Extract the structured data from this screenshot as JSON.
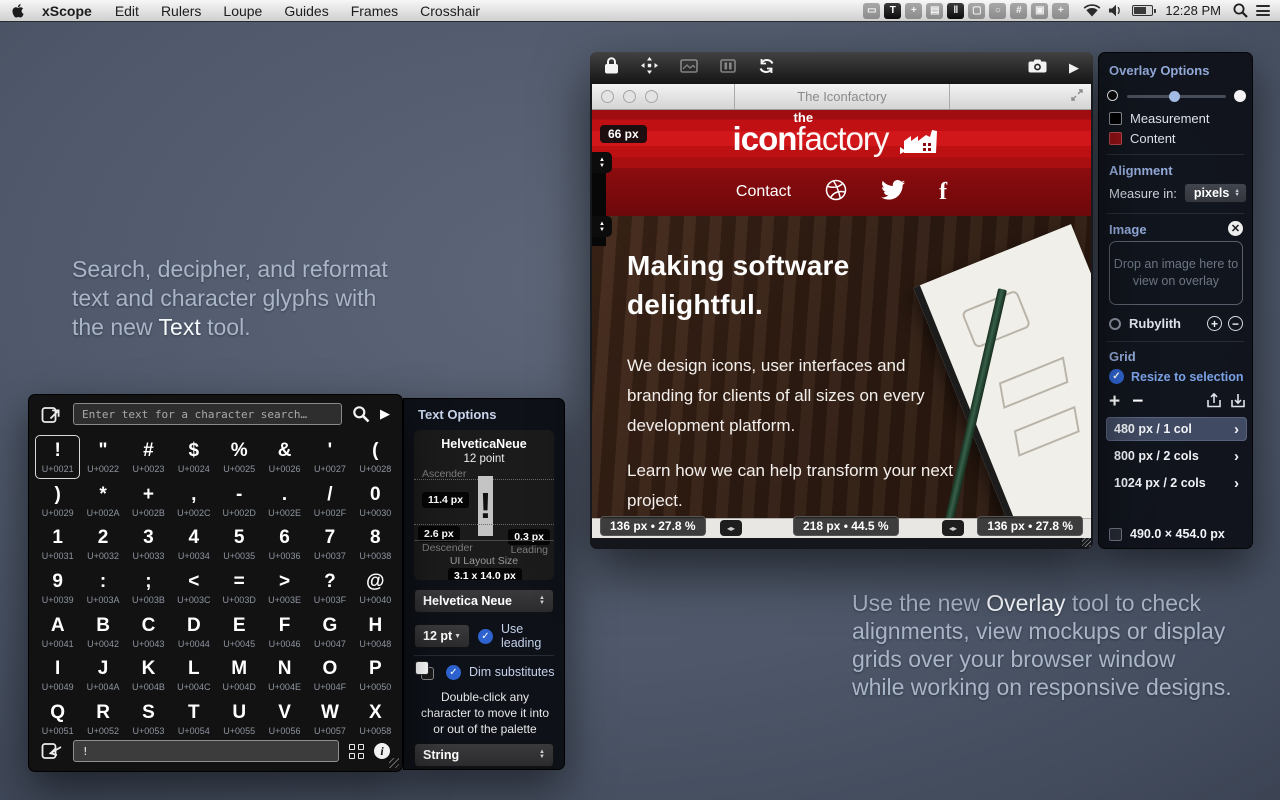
{
  "menu_bar": {
    "items": [
      "xScope",
      "Edit",
      "Rulers",
      "Loupe",
      "Guides",
      "Frames",
      "Crosshair"
    ],
    "clock": "12:28 PM",
    "tool_icons": [
      {
        "name": "dimensions-tool",
        "glyph": "▭",
        "active": false
      },
      {
        "name": "text-tool",
        "glyph": "T",
        "active": true
      },
      {
        "name": "crosshair-tool",
        "glyph": "+",
        "active": false
      },
      {
        "name": "ruler-tool",
        "glyph": "▤",
        "active": false
      },
      {
        "name": "columns-tool",
        "glyph": "‖",
        "active": true
      },
      {
        "name": "frames-tool",
        "glyph": "▢",
        "active": false
      },
      {
        "name": "loupe-tool",
        "glyph": "○",
        "active": false
      },
      {
        "name": "grid-tool",
        "glyph": "#",
        "active": false
      },
      {
        "name": "overlay-tool",
        "glyph": "▣",
        "active": false
      },
      {
        "name": "guides-tool",
        "glyph": "+",
        "active": false
      }
    ]
  },
  "captions": {
    "left_pre": "Search, decipher, and reformat\ntext and character glyphs with\nthe new ",
    "left_hl": "Text",
    "left_post": " tool.",
    "right_pre": "Use the new ",
    "right_hl": "Overlay",
    "right_post": " tool to check\nalignments, view mockups or display\ngrids over your browser window\nwhile working on responsive designs."
  },
  "palette": {
    "search_placeholder": "Enter text for a character search…",
    "input_value": "!",
    "cells": [
      {
        "c": "!",
        "u": "U+0021",
        "selected": true
      },
      {
        "c": "\"",
        "u": "U+0022"
      },
      {
        "c": "#",
        "u": "U+0023"
      },
      {
        "c": "$",
        "u": "U+0024"
      },
      {
        "c": "%",
        "u": "U+0025"
      },
      {
        "c": "&",
        "u": "U+0026"
      },
      {
        "c": "'",
        "u": "U+0027"
      },
      {
        "c": "(",
        "u": "U+0028"
      },
      {
        "c": ")",
        "u": "U+0029"
      },
      {
        "c": "*",
        "u": "U+002A"
      },
      {
        "c": "+",
        "u": "U+002B"
      },
      {
        "c": ",",
        "u": "U+002C"
      },
      {
        "c": "-",
        "u": "U+002D"
      },
      {
        "c": ".",
        "u": "U+002E"
      },
      {
        "c": "/",
        "u": "U+002F"
      },
      {
        "c": "0",
        "u": "U+0030"
      },
      {
        "c": "1",
        "u": "U+0031"
      },
      {
        "c": "2",
        "u": "U+0032"
      },
      {
        "c": "3",
        "u": "U+0033"
      },
      {
        "c": "4",
        "u": "U+0034"
      },
      {
        "c": "5",
        "u": "U+0035"
      },
      {
        "c": "6",
        "u": "U+0036"
      },
      {
        "c": "7",
        "u": "U+0037"
      },
      {
        "c": "8",
        "u": "U+0038"
      },
      {
        "c": "9",
        "u": "U+0039"
      },
      {
        "c": ":",
        "u": "U+003A"
      },
      {
        "c": ";",
        "u": "U+003B"
      },
      {
        "c": "<",
        "u": "U+003C"
      },
      {
        "c": "=",
        "u": "U+003D"
      },
      {
        "c": ">",
        "u": "U+003E"
      },
      {
        "c": "?",
        "u": "U+003F"
      },
      {
        "c": "@",
        "u": "U+0040"
      },
      {
        "c": "A",
        "u": "U+0041"
      },
      {
        "c": "B",
        "u": "U+0042"
      },
      {
        "c": "C",
        "u": "U+0043"
      },
      {
        "c": "D",
        "u": "U+0044"
      },
      {
        "c": "E",
        "u": "U+0045"
      },
      {
        "c": "F",
        "u": "U+0046"
      },
      {
        "c": "G",
        "u": "U+0047"
      },
      {
        "c": "H",
        "u": "U+0048"
      },
      {
        "c": "I",
        "u": "U+0049"
      },
      {
        "c": "J",
        "u": "U+004A"
      },
      {
        "c": "K",
        "u": "U+004B"
      },
      {
        "c": "L",
        "u": "U+004C"
      },
      {
        "c": "M",
        "u": "U+004D"
      },
      {
        "c": "N",
        "u": "U+004E"
      },
      {
        "c": "O",
        "u": "U+004F"
      },
      {
        "c": "P",
        "u": "U+0050"
      },
      {
        "c": "Q",
        "u": "U+0051"
      },
      {
        "c": "R",
        "u": "U+0052"
      },
      {
        "c": "S",
        "u": "U+0053"
      },
      {
        "c": "T",
        "u": "U+0054"
      },
      {
        "c": "U",
        "u": "U+0055"
      },
      {
        "c": "V",
        "u": "U+0056"
      },
      {
        "c": "W",
        "u": "U+0057"
      },
      {
        "c": "X",
        "u": "U+0058"
      }
    ]
  },
  "text_options": {
    "title": "Text Options",
    "preview_font": "HelveticaNeue",
    "preview_size": "12 point",
    "glyph": "!",
    "ascender_label": "Ascender",
    "ascender_value": "11.4 px",
    "descender_label": "Descender",
    "descender_value": "2.6 px",
    "leading_label": "Leading",
    "leading_value": "0.3 px",
    "layout_label": "UI Layout Size",
    "layout_value": "3.1 x 14.0 px",
    "font_dropdown": "Helvetica Neue",
    "size_dropdown": "12 pt",
    "use_leading": "Use leading",
    "dim_substitutes": "Dim substitutes",
    "hint": "Double-click any\ncharacter to move it into\nor out of the palette",
    "string_dropdown": "String"
  },
  "overlay_window": {
    "title": "The Iconfactory",
    "height_badge": "66 px",
    "logo_the": "the",
    "logo_icon": "icon",
    "logo_factory": "factory",
    "nav_contact": "Contact",
    "hero": "Making software\ndelightful.",
    "para1": "We design icons, user interfaces and\nbranding for clients of all sizes on every\ndevelopment platform.",
    "para2": "Learn how we can help transform your next\nproject.",
    "measure_left": "136 px • 27.8 %",
    "measure_center": "218 px • 44.5 %",
    "measure_right": "136 px • 27.8 %"
  },
  "overlay_options": {
    "title": "Overlay Options",
    "measurement": "Measurement",
    "content": "Content",
    "alignment": "Alignment",
    "measure_in": "Measure in:",
    "units": "pixels",
    "image": "Image",
    "dropzone": "Drop an image here to\nview on overlay",
    "rubylith": "Rubylith",
    "grid": "Grid",
    "resize": "Resize to selection",
    "rows": [
      "480 px / 1 col",
      "800 px / 2 cols",
      "1024 px / 2 cols"
    ],
    "size_label": "490.0 × 454.0 px",
    "check": "✓"
  }
}
